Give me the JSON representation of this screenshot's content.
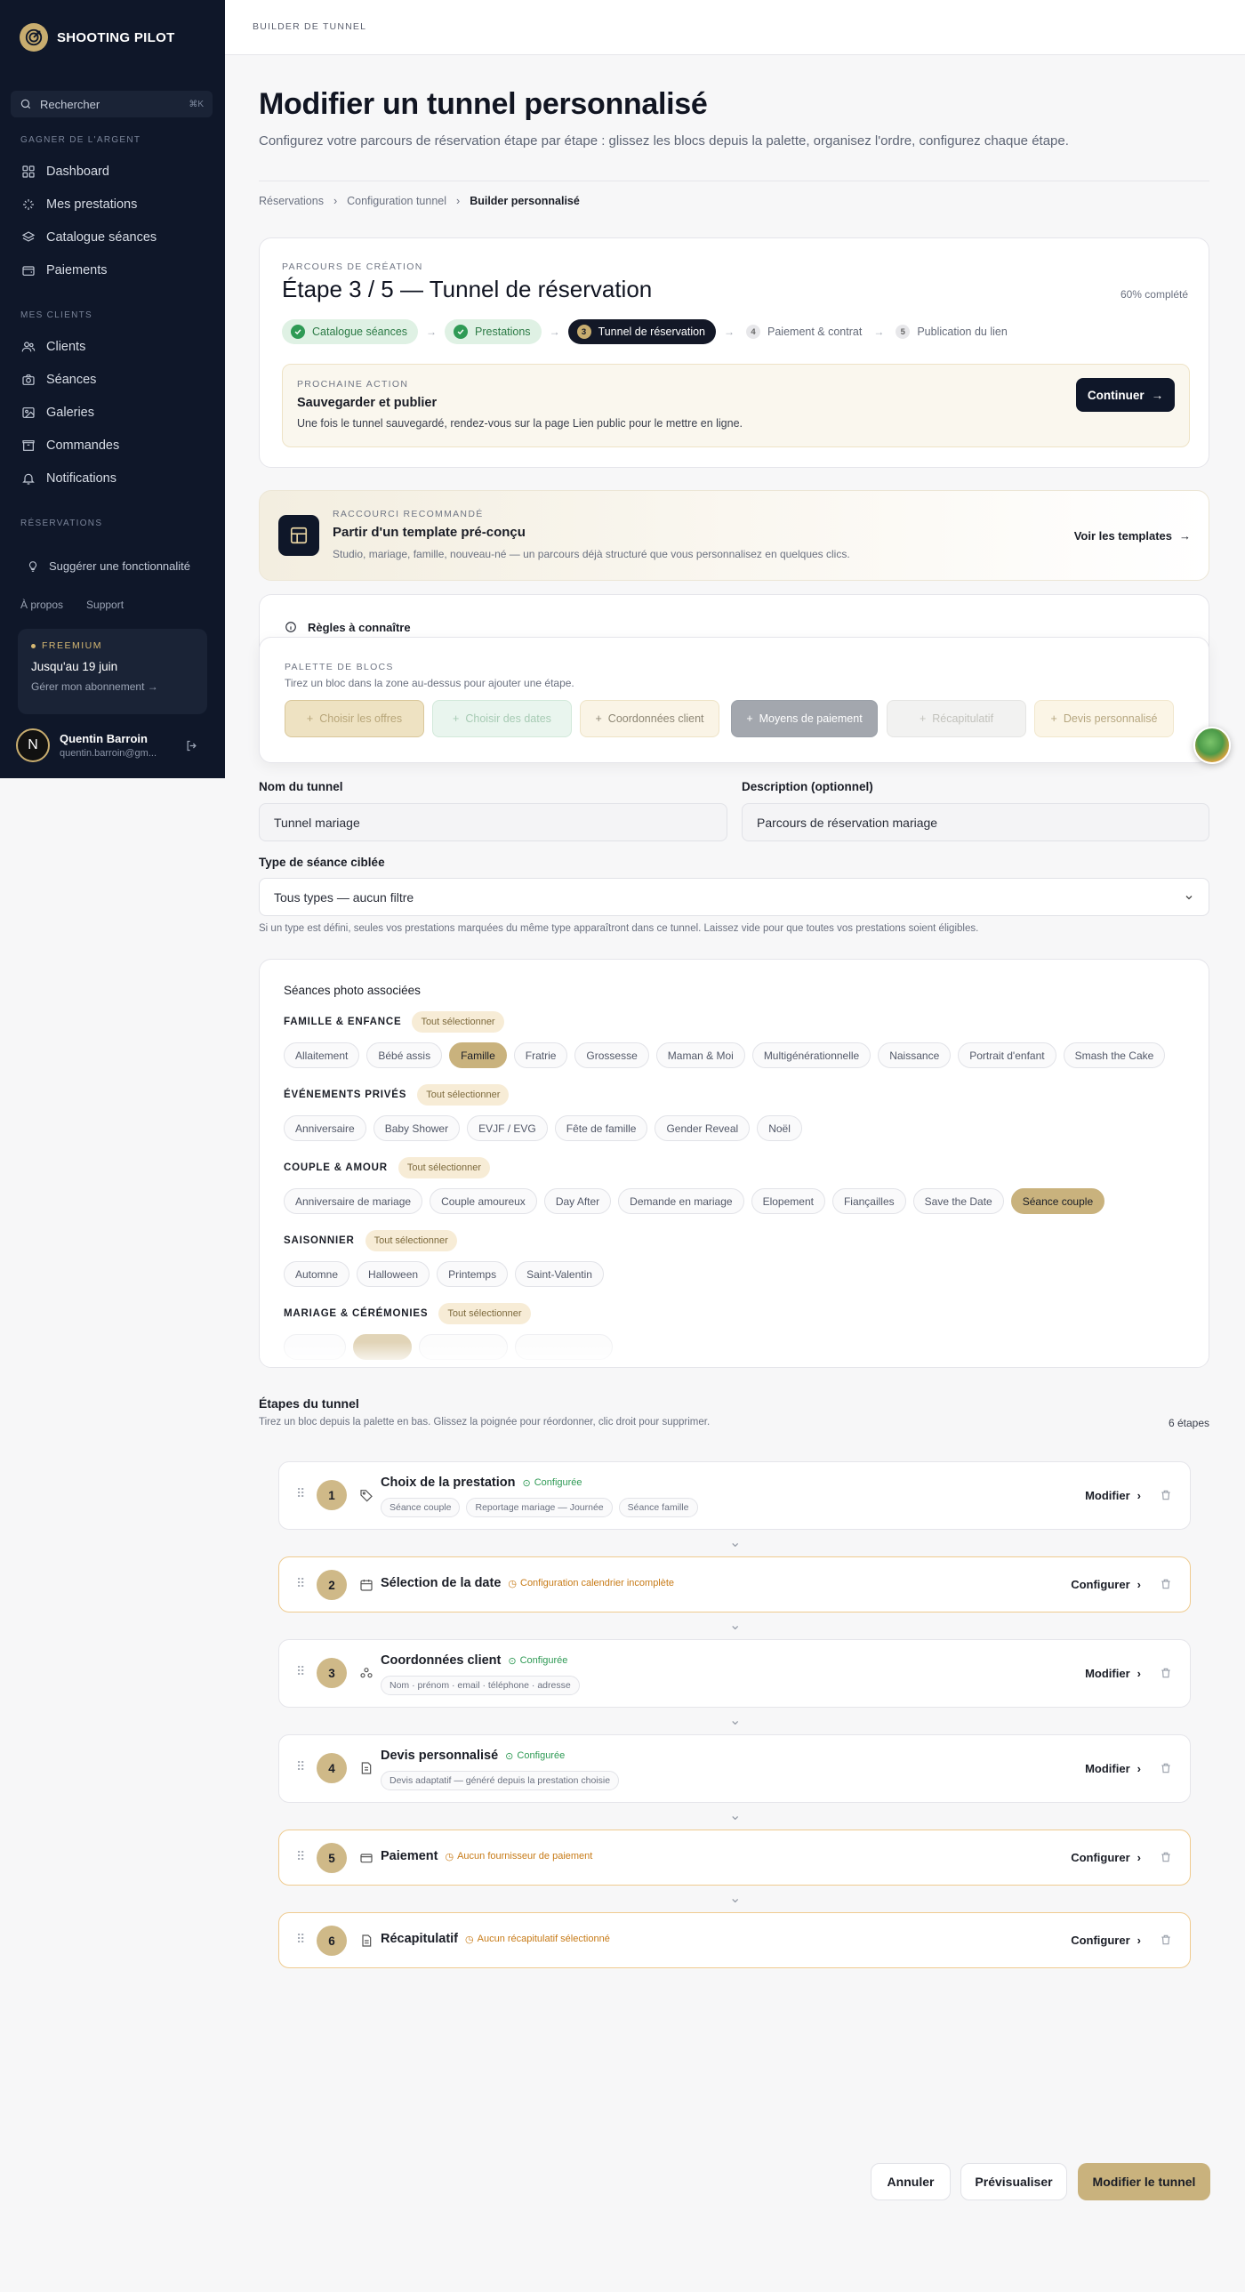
{
  "app": {
    "name": "SHOOTING PILOT",
    "accent": "#c8ad6f",
    "sidebar_bg": "#0f1729"
  },
  "sidebar": {
    "search_placeholder": "Rechercher",
    "search_shortcut": "⌘K",
    "section_money": "GAGNER DE L'ARGENT",
    "money_items": [
      {
        "label": "Dashboard",
        "icon": "grid-icon"
      },
      {
        "label": "Mes prestations",
        "icon": "sparkle-icon"
      },
      {
        "label": "Catalogue séances",
        "icon": "layers-icon"
      },
      {
        "label": "Paiements",
        "icon": "wallet-icon"
      }
    ],
    "section_clients": "MES CLIENTS",
    "client_items": [
      {
        "label": "Clients",
        "icon": "users-icon"
      },
      {
        "label": "Séances",
        "icon": "camera-icon"
      },
      {
        "label": "Galeries",
        "icon": "image-icon"
      },
      {
        "label": "Commandes",
        "icon": "box-icon"
      },
      {
        "label": "Notifications",
        "icon": "bell-icon"
      }
    ],
    "section_reservations": "RÉSERVATIONS",
    "suggest": "Suggérer une fonctionnalité",
    "links": [
      "À propos",
      "Support"
    ],
    "plan": {
      "badge": "FREEMIUM",
      "until": "Jusqu'au 19 juin",
      "manage": "Gérer mon abonnement →"
    },
    "user": {
      "initial": "N",
      "name": "Quentin Barroin",
      "email": "quentin.barroin@gm..."
    }
  },
  "topbar": {
    "title": "BUILDER DE TUNNEL"
  },
  "page": {
    "title": "Modifier un tunnel personnalisé",
    "subtitle": "Configurez votre parcours de réservation étape par étape : glissez les blocs depuis la palette, organisez l'ordre, configurez chaque étape.",
    "breadcrumb": [
      "Réservations",
      "Configuration tunnel",
      "Builder personnalisé"
    ]
  },
  "progress_card": {
    "eyebrow": "PARCOURS DE CRÉATION",
    "title": "Étape 3 / 5 — Tunnel de réservation",
    "completion": "60% complété",
    "steps": [
      {
        "label": "Catalogue séances",
        "state": "done"
      },
      {
        "label": "Prestations",
        "state": "done"
      },
      {
        "num": "3",
        "label": "Tunnel de réservation",
        "state": "active"
      },
      {
        "num": "4",
        "label": "Paiement & contrat",
        "state": "todo"
      },
      {
        "num": "5",
        "label": "Publication du lien",
        "state": "todo"
      }
    ],
    "next_eyebrow": "PROCHAINE ACTION",
    "next_title": "Sauvegarder et publier",
    "next_desc": "Une fois le tunnel sauvegardé, rendez-vous sur la page Lien public pour le mettre en ligne.",
    "continue": "Continuer"
  },
  "template_card": {
    "eyebrow": "RACCOURCI RECOMMANDÉ",
    "title": "Partir d'un template pré-conçu",
    "desc": "Studio, mariage, famille, nouveau-né — un parcours déjà structuré que vous personnalisez en quelques clics.",
    "cta": "Voir les templates"
  },
  "rules": {
    "label": "Règles à connaître"
  },
  "palette": {
    "eyebrow": "PALETTE DE BLOCS",
    "hint": "Tirez un bloc dans la zone au-dessus pour ajouter une étape.",
    "blocks": [
      {
        "label": "Choisir les offres",
        "bg": "#eee2c2",
        "fg": "#b8a67a"
      },
      {
        "label": "Choisir des dates",
        "bg": "#e9f5ee",
        "fg": "#a7cbb4"
      },
      {
        "label": "Coordonnées client",
        "bg": "#faf4e6",
        "fg": "#8e8775"
      },
      {
        "label": "Moyens de paiement",
        "bg": "#a3a7ae",
        "fg": "#ffffff"
      },
      {
        "label": "Récapitulatif",
        "bg": "#f2f2f1",
        "fg": "#c2c2bc"
      },
      {
        "label": "Devis personnalisé",
        "bg": "#fbf5e6",
        "fg": "#b6a781"
      }
    ]
  },
  "form": {
    "name_label": "Nom du tunnel",
    "name_value": "Tunnel mariage",
    "desc_label": "Description (optionnel)",
    "desc_value": "Parcours de réservation mariage",
    "type_label": "Type de séance ciblée",
    "type_value": "Tous types — aucun filtre",
    "type_hint": "Si un type est défini, seules vos prestations marquées du même type apparaîtront dans ce tunnel. Laissez vide pour que toutes vos prestations soient éligibles."
  },
  "seances": {
    "title": "Séances photo associées",
    "select_all": "Tout sélectionner",
    "categories": [
      {
        "name": "FAMILLE & ENFANCE",
        "tags": [
          "Allaitement",
          "Bébé assis",
          "Famille",
          "Fratrie",
          "Grossesse",
          "Maman & Moi",
          "Multigénérationnelle",
          "Naissance",
          "Portrait d'enfant",
          "Smash the Cake"
        ],
        "selected": [
          "Famille"
        ]
      },
      {
        "name": "ÉVÉNEMENTS PRIVÉS",
        "tags": [
          "Anniversaire",
          "Baby Shower",
          "EVJF / EVG",
          "Fête de famille",
          "Gender Reveal",
          "Noël"
        ],
        "selected": []
      },
      {
        "name": "COUPLE & AMOUR",
        "tags": [
          "Anniversaire de mariage",
          "Couple amoureux",
          "Day After",
          "Demande en mariage",
          "Elopement",
          "Fiançailles",
          "Save the Date",
          "Séance couple"
        ],
        "selected": [
          "Séance couple"
        ]
      },
      {
        "name": "SAISONNIER",
        "tags": [
          "Automne",
          "Halloween",
          "Printemps",
          "Saint-Valentin"
        ],
        "selected": []
      },
      {
        "name": "MARIAGE & CÉRÉMONIES",
        "tags": [],
        "selected": []
      }
    ]
  },
  "tunnel": {
    "title": "Étapes du tunnel",
    "hint": "Tirez un bloc depuis la palette en bas. Glissez la poignée pour réordonner, clic droit pour supprimer.",
    "count": "6 étapes",
    "steps": [
      {
        "num": "1",
        "title": "Choix de la prestation",
        "status": "Configurée",
        "ok": true,
        "tags": [
          "Séance couple",
          "Reportage mariage — Journée",
          "Séance famille"
        ],
        "action": "Modifier",
        "icon": "tag-icon"
      },
      {
        "num": "2",
        "title": "Sélection de la date",
        "status": "Configuration calendrier incomplète",
        "ok": false,
        "tags": [],
        "action": "Configurer",
        "icon": "calendar-icon"
      },
      {
        "num": "3",
        "title": "Coordonnées client",
        "status": "Configurée",
        "ok": true,
        "tags": [
          "Nom · prénom · email · téléphone · adresse"
        ],
        "action": "Modifier",
        "icon": "contacts-icon"
      },
      {
        "num": "4",
        "title": "Devis personnalisé",
        "status": "Configurée",
        "ok": true,
        "tags": [
          "Devis adaptatif — généré depuis la prestation choisie"
        ],
        "action": "Modifier",
        "icon": "quote-icon"
      },
      {
        "num": "5",
        "title": "Paiement",
        "status": "Aucun fournisseur de paiement",
        "ok": false,
        "tags": [],
        "action": "Configurer",
        "icon": "card-icon"
      },
      {
        "num": "6",
        "title": "Récapitulatif",
        "status": "Aucun récapitulatif sélectionné",
        "ok": false,
        "tags": [],
        "action": "Configurer",
        "icon": "document-icon"
      }
    ]
  },
  "footer": {
    "cancel": "Annuler",
    "preview": "Prévisualiser",
    "submit": "Modifier le tunnel"
  }
}
